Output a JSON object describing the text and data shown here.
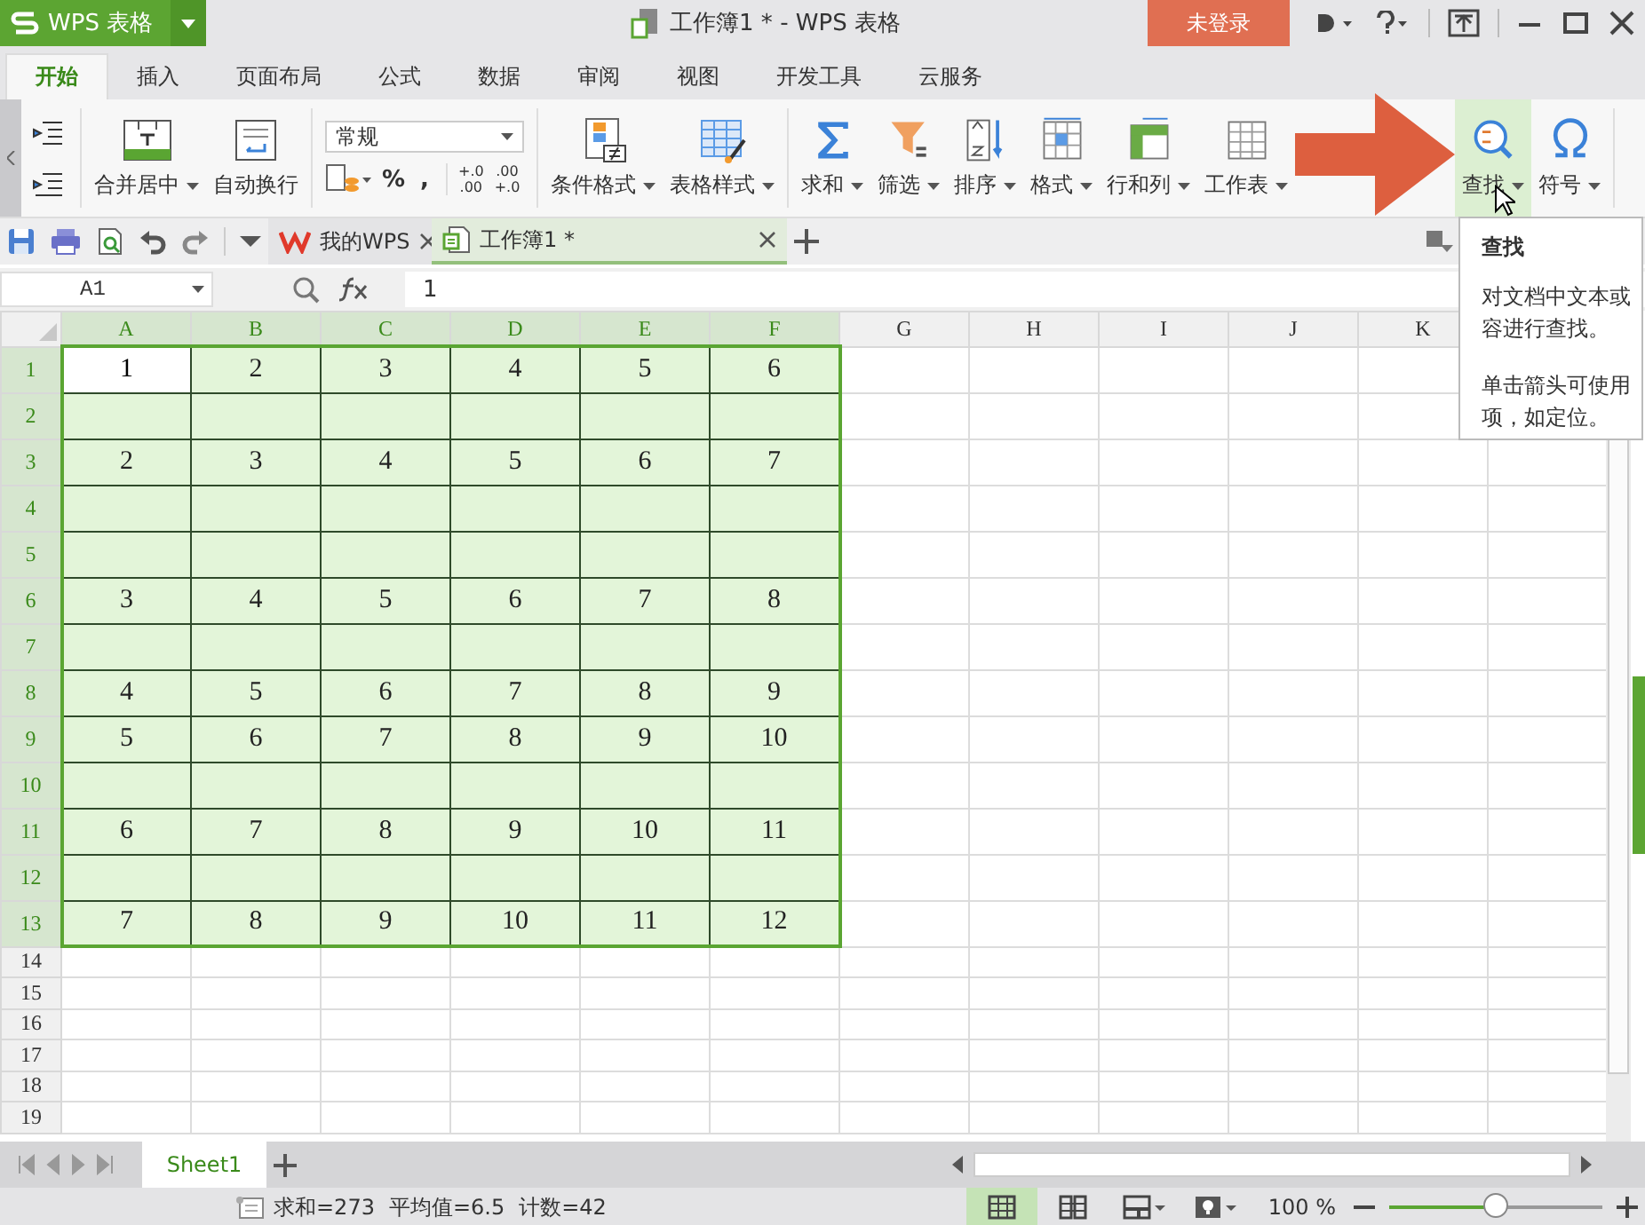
{
  "app": {
    "name": "WPS 表格",
    "title": "工作簿1 * - WPS 表格",
    "login": "未登录"
  },
  "tabs": [
    {
      "label": "开始",
      "selected": true
    },
    {
      "label": "插入",
      "selected": false
    },
    {
      "label": "页面布局",
      "selected": false
    },
    {
      "label": "公式",
      "selected": false
    },
    {
      "label": "数据",
      "selected": false
    },
    {
      "label": "审阅",
      "selected": false
    },
    {
      "label": "视图",
      "selected": false
    },
    {
      "label": "开发工具",
      "selected": false
    },
    {
      "label": "云服务",
      "selected": false
    }
  ],
  "ribbon": {
    "merge_buttons": [
      {
        "label": "合并居中",
        "dropdown": true
      },
      {
        "label": "自动换行",
        "dropdown": false
      }
    ],
    "number_format": {
      "value": "常规"
    },
    "number_buttons": [
      {
        "label": "%"
      },
      {
        "label": ","
      }
    ],
    "decimal_buttons": [
      {
        "top": "+.0",
        "bottom": ".00"
      },
      {
        "top": ".00",
        "bottom": "+.0"
      }
    ],
    "style_buttons": [
      {
        "label": "条件格式",
        "dropdown": true
      },
      {
        "label": "表格样式",
        "dropdown": true
      }
    ],
    "edit_buttons": [
      {
        "label": "求和",
        "dropdown": true,
        "hovered": false
      },
      {
        "label": "筛选",
        "dropdown": true,
        "hovered": false
      },
      {
        "label": "排序",
        "dropdown": true,
        "hovered": false
      },
      {
        "label": "格式",
        "dropdown": true,
        "hovered": false
      },
      {
        "label": "行和列",
        "dropdown": true,
        "hovered": false
      },
      {
        "label": "工作表",
        "dropdown": true,
        "hovered": false
      }
    ],
    "find_buttons": [
      {
        "label": "查找",
        "dropdown": true,
        "hovered": true
      },
      {
        "label": "符号",
        "dropdown": true,
        "hovered": false
      }
    ]
  },
  "doc_tabs": [
    {
      "label": "我的WPS",
      "selected": false
    },
    {
      "label": "工作簿1 *",
      "selected": true
    }
  ],
  "formula_bar": {
    "name_box": "A1",
    "value": "1"
  },
  "sheet": {
    "columns": [
      {
        "label": "A",
        "selected": true
      },
      {
        "label": "B",
        "selected": true
      },
      {
        "label": "C",
        "selected": true
      },
      {
        "label": "D",
        "selected": true
      },
      {
        "label": "E",
        "selected": true
      },
      {
        "label": "F",
        "selected": true
      },
      {
        "label": "G",
        "selected": false
      },
      {
        "label": "H",
        "selected": false
      },
      {
        "label": "I",
        "selected": false
      },
      {
        "label": "J",
        "selected": false
      },
      {
        "label": "K",
        "selected": false
      }
    ],
    "rows": [
      {
        "label": "1",
        "selected": true,
        "cells": [
          {
            "value": "1",
            "active": true
          },
          {
            "value": "2",
            "active": false
          },
          {
            "value": "3",
            "active": false
          },
          {
            "value": "4",
            "active": false
          },
          {
            "value": "5",
            "active": false
          },
          {
            "value": "6",
            "active": false
          }
        ]
      },
      {
        "label": "2",
        "selected": true
      },
      {
        "label": "3",
        "selected": true,
        "cells": [
          {
            "value": "2",
            "active": false
          },
          {
            "value": "3",
            "active": false
          },
          {
            "value": "4",
            "active": false
          },
          {
            "value": "5",
            "active": false
          },
          {
            "value": "6",
            "active": false
          },
          {
            "value": "7",
            "active": false
          }
        ]
      },
      {
        "label": "4",
        "selected": true
      },
      {
        "label": "5",
        "selected": true
      },
      {
        "label": "6",
        "selected": true,
        "cells": [
          {
            "value": "3",
            "active": false
          },
          {
            "value": "4",
            "active": false
          },
          {
            "value": "5",
            "active": false
          },
          {
            "value": "6",
            "active": false
          },
          {
            "value": "7",
            "active": false
          },
          {
            "value": "8",
            "active": false
          }
        ]
      },
      {
        "label": "7",
        "selected": true
      },
      {
        "label": "8",
        "selected": true,
        "cells": [
          {
            "value": "4",
            "active": false
          },
          {
            "value": "5",
            "active": false
          },
          {
            "value": "6",
            "active": false
          },
          {
            "value": "7",
            "active": false
          },
          {
            "value": "8",
            "active": false
          },
          {
            "value": "9",
            "active": false
          }
        ]
      },
      {
        "label": "9",
        "selected": true,
        "cells": [
          {
            "value": "5",
            "active": false
          },
          {
            "value": "6",
            "active": false
          },
          {
            "value": "7",
            "active": false
          },
          {
            "value": "8",
            "active": false
          },
          {
            "value": "9",
            "active": false
          },
          {
            "value": "10",
            "active": false
          }
        ]
      },
      {
        "label": "10",
        "selected": true
      },
      {
        "label": "11",
        "selected": true,
        "cells": [
          {
            "value": "6",
            "active": false
          },
          {
            "value": "7",
            "active": false
          },
          {
            "value": "8",
            "active": false
          },
          {
            "value": "9",
            "active": false
          },
          {
            "value": "10",
            "active": false
          },
          {
            "value": "11",
            "active": false
          }
        ]
      },
      {
        "label": "12",
        "selected": true
      },
      {
        "label": "13",
        "selected": true,
        "cells": [
          {
            "value": "7",
            "active": false
          },
          {
            "value": "8",
            "active": false
          },
          {
            "value": "9",
            "active": false
          },
          {
            "value": "10",
            "active": false
          },
          {
            "value": "11",
            "active": false
          },
          {
            "value": "12",
            "active": false
          }
        ]
      },
      {
        "label": "14",
        "selected": false
      },
      {
        "label": "15",
        "selected": false
      },
      {
        "label": "16",
        "selected": false
      },
      {
        "label": "17",
        "selected": false
      },
      {
        "label": "18",
        "selected": false
      },
      {
        "label": "19",
        "selected": false
      }
    ]
  },
  "tooltip": {
    "title": "查找",
    "paragraphs": [
      "对文档中文本或容进行查找。",
      "单击箭头可使用项，如定位。"
    ]
  },
  "sheet_tabs": [
    {
      "label": "Sheet1",
      "selected": true
    }
  ],
  "status_bar": {
    "stats": [
      "求和=273",
      "平均值=6.5",
      "计数=42"
    ],
    "zoom": "100 %",
    "zoom_slider": {
      "level": 0.5
    }
  }
}
